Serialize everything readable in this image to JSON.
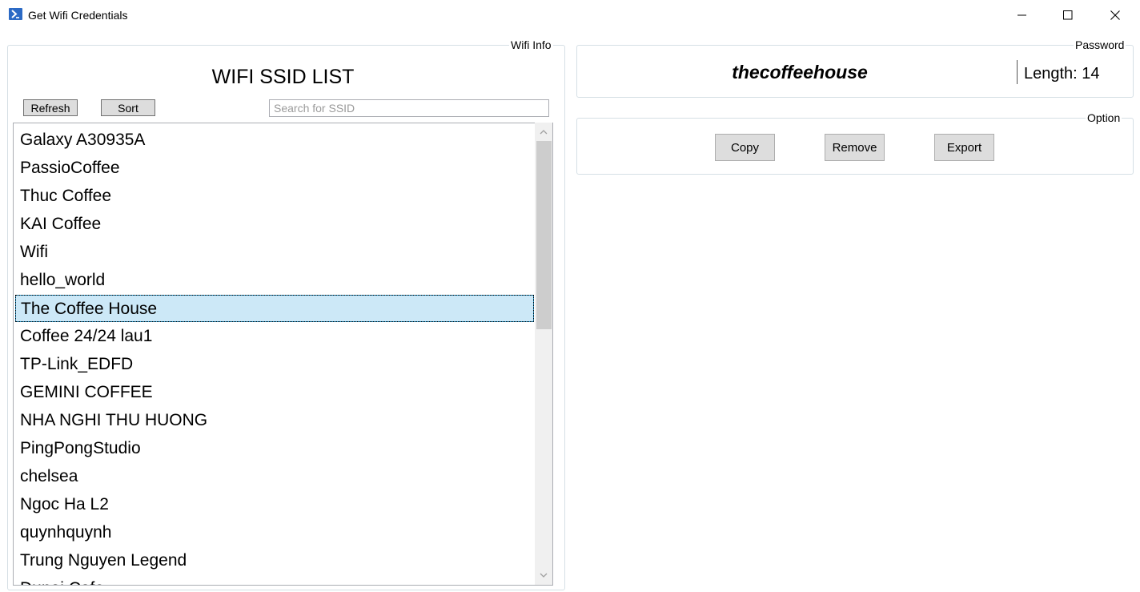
{
  "window": {
    "title": "Get Wifi Credentials",
    "icon": "powershell-icon",
    "controls": [
      "minimize-icon",
      "maximize-icon",
      "close-icon"
    ]
  },
  "wifi_info": {
    "group_title": "Wifi Info",
    "heading": "WIFI SSID LIST",
    "refresh_label": "Refresh",
    "sort_label": "Sort",
    "search_placeholder": "Search for SSID",
    "search_value": "",
    "selected_index": 6,
    "items": [
      "Galaxy A30935A",
      "PassioCoffee",
      "Thuc Coffee",
      "KAI Coffee",
      "Wifi",
      "hello_world",
      "The Coffee House",
      "Coffee 24/24 lau1",
      "TP-Link_EDFD",
      "GEMINI COFFEE",
      "NHA NGHI THU HUONG",
      "PingPongStudio",
      "chelsea",
      "Ngoc Ha L2",
      "quynhquynh",
      "Trung Nguyen Legend",
      "Dunai Cafe"
    ]
  },
  "password": {
    "group_title": "Password",
    "value": "thecoffeehouse",
    "length_text": "Length: 14"
  },
  "option": {
    "group_title": "Option",
    "copy_label": "Copy",
    "remove_label": "Remove",
    "export_label": "Export"
  },
  "colors": {
    "selection_bg": "#cce8f7",
    "selection_border": "#26a0da",
    "button_bg": "#dddddd",
    "group_border": "#d5dfe5",
    "icon_blue": "#2c6ac5"
  }
}
